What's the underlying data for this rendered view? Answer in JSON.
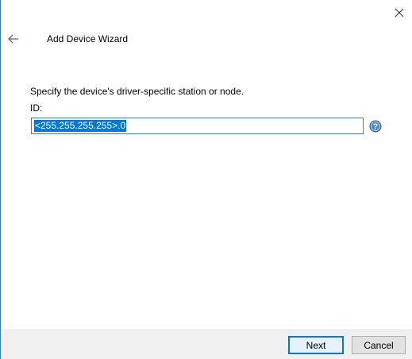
{
  "wizard": {
    "title": "Add Device Wizard",
    "prompt": "Specify the device's driver-specific station or node.",
    "id_label": "ID:",
    "id_value": "<255.255.255.255>.0"
  },
  "icons": {
    "close": "close-icon",
    "back": "back-arrow-icon",
    "help": "help-icon"
  },
  "buttons": {
    "next": "Next",
    "cancel": "Cancel"
  },
  "colors": {
    "accent": "#0078d7",
    "border": "#2b7bd6",
    "footer": "#f0f0f0"
  }
}
